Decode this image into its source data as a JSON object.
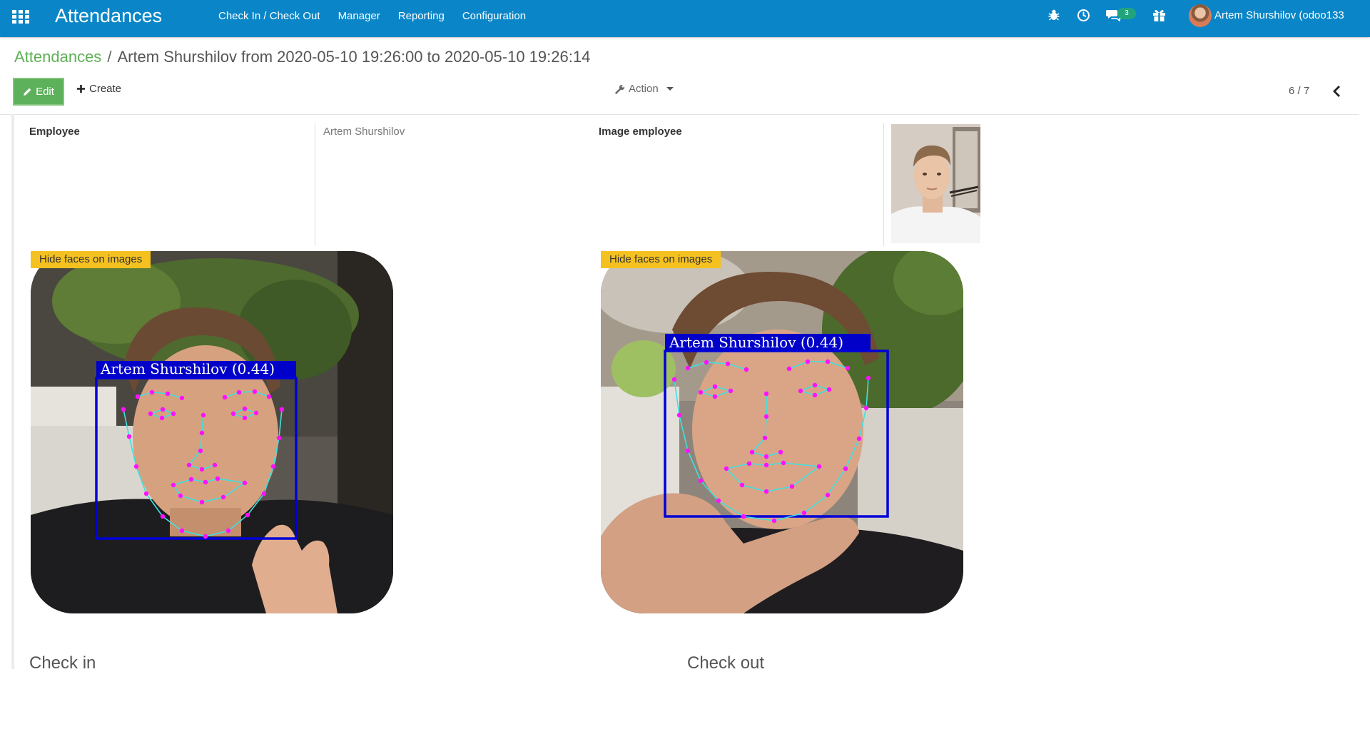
{
  "navbar": {
    "app_title": "Attendances",
    "menu": [
      "Check In / Check Out",
      "Manager",
      "Reporting",
      "Configuration"
    ],
    "icons": [
      "apps-grid-icon",
      "bug-icon",
      "clock-icon",
      "chat-icon",
      "gift-icon"
    ],
    "messages_count": "3",
    "user_name": "Artem Shurshilov (odoo133",
    "color": "#0a86c8"
  },
  "breadcrumb": {
    "parent": "Attendances",
    "separator": "/",
    "current": "Artem Shurshilov from 2020-05-10 19:26:00 to 2020-05-10 19:26:14"
  },
  "control_panel": {
    "edit_label": "Edit",
    "create_label": "Create",
    "action_label": "Action",
    "pager": "6 / 7"
  },
  "form": {
    "employee_label": "Employee",
    "employee_value": "Artem Shurshilov",
    "image_employee_label": "Image employee",
    "hide_faces_label": "Hide faces on images",
    "check_in_face_caption": "Artem Shurshilov (0.44)",
    "check_out_face_caption": "Artem Shurshilov (0.44)",
    "check_in_title": "Check in",
    "check_out_title": "Check out"
  }
}
